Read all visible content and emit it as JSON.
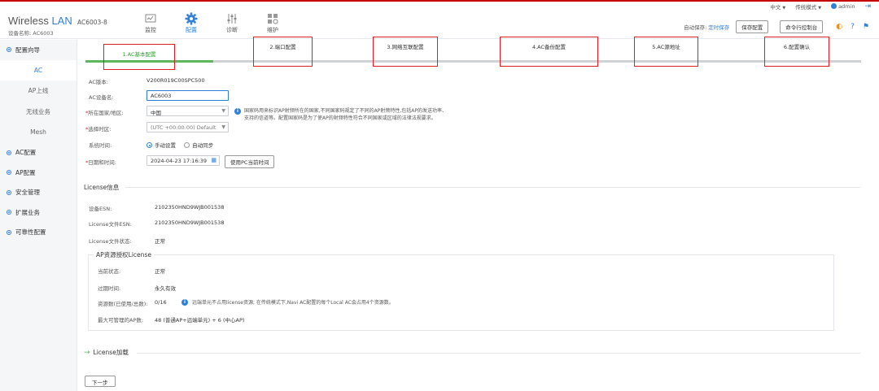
{
  "util": {
    "lang": "中文",
    "mode": "传统模式",
    "user": "admin"
  },
  "brand": {
    "title_main": "Wireless ",
    "title_accent": "LAN",
    "model": "AC6003-8",
    "device_label": "设备名称:",
    "device_name": "AC6003"
  },
  "nav": [
    {
      "label": "监控",
      "icon": "monitor-icon",
      "active": false
    },
    {
      "label": "配置",
      "icon": "gear-icon",
      "active": true
    },
    {
      "label": "诊断",
      "icon": "sliders-icon",
      "active": false
    },
    {
      "label": "维护",
      "icon": "maintenance-icon",
      "active": false
    }
  ],
  "header_right": {
    "auto_save_label": "自动保存:",
    "auto_save_link": "定时保存",
    "save_config": "保存配置",
    "cmd_console": "命令行控制台"
  },
  "sidebar": {
    "wizard": "配置向导",
    "sub": [
      "AC",
      "AP上线",
      "无线业务",
      "Mesh"
    ],
    "items": [
      "AC配置",
      "AP配置",
      "安全管理",
      "扩展业务",
      "可靠性配置"
    ]
  },
  "steps": [
    "1.AC基本配置",
    "2.端口配置",
    "3.网络互联配置",
    "4.AC备份配置",
    "5.AC源地址",
    "6.配置确认"
  ],
  "form": {
    "version_label": "AC版本:",
    "version_value": "V200R019C00SPC500",
    "devname_label": "AC设备名:",
    "devname_value": "AC6003",
    "country_label": "所在国家/地区:",
    "country_value": "中国",
    "country_note_1": "国家码用来标识AP射频所在的国家,不同国家码规定了不同的AP射频特性,包括AP的发送功率、",
    "country_note_2": "支持的信道等。配置国家码是为了使AP的射频特性符合不同国家或区域的法律法规要求。",
    "tz_label": "选择时区:",
    "tz_value": "(UTC +00:00:00) Default",
    "systime_label": "系统时间:",
    "manual": "手动设置",
    "auto": "自动同步",
    "datetime_label": "日期和时间:",
    "datetime_value": "2024-04-23 17:16:39",
    "use_pc_time": "使用PC当前时间"
  },
  "license": {
    "section": "License信息",
    "esn_label": "设备ESN:",
    "esn_value": "2102350HND9WJB001538",
    "file_esn_label": "License文件ESN:",
    "file_esn_value": "2102350HND9WJB001538",
    "file_state_label": "License文件状态:",
    "file_state_value": "正常",
    "ap_section": "AP资源授权License",
    "cur_state_label": "当前状态:",
    "cur_state_value": "正常",
    "expire_label": "过期时间:",
    "expire_value": "永久有效",
    "res_label": "资源数(已使用/总数):",
    "res_value": "0/16",
    "res_note": "远端单元不占用license资源; 在传统模式下,Navi AC配置的每个Local AC会占用4个资源数。",
    "max_ap_label": "最大可管理的AP数:",
    "max_ap_value": "48 (普通AP+远端单元) + 6 (中心AP)",
    "load": "License加载"
  },
  "next": "下一步"
}
